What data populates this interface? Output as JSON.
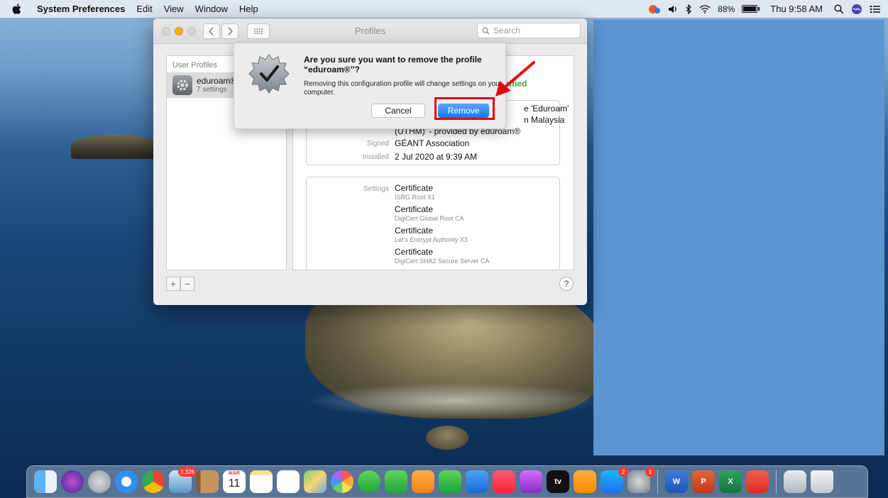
{
  "menubar": {
    "app_name": "System Preferences",
    "menus": [
      "Edit",
      "View",
      "Window",
      "Help"
    ],
    "battery": "88%",
    "battery_level": 0.88,
    "clock": "Thu 9:58 AM"
  },
  "window": {
    "title": "Profiles",
    "search_placeholder": "Search",
    "sidebar_header": "User Profiles",
    "profile_name": "eduroam®",
    "profile_settings": "7 settings",
    "verified": "rified",
    "info": {
      "line1": "e 'Eduroam'",
      "line2": "n Malaysia",
      "line3": "(UTHM)' - provided by eduroam®",
      "signed_label": "Signed",
      "signed_value": "GÉANT Association",
      "installed_label": "Installed",
      "installed_value": "2 Jul 2020 at 9:39 AM"
    },
    "settings_label": "Settings",
    "certificates": [
      {
        "title": "Certificate",
        "subtitle": "ISRG Root X1"
      },
      {
        "title": "Certificate",
        "subtitle": "DigiCert Global Root CA"
      },
      {
        "title": "Certificate",
        "subtitle": "Let's Encrypt Authority X3"
      },
      {
        "title": "Certificate",
        "subtitle": "DigiCert SHA2 Secure Server CA"
      }
    ],
    "help": "?"
  },
  "sheet": {
    "title": "Are you sure you want to remove the profile “eduroam®”?",
    "message": "Removing this configuration profile will change settings on your computer.",
    "cancel": "Cancel",
    "remove": "Remove"
  },
  "dock": {
    "photos_badge": "3,326",
    "calendar_month": "MAR",
    "calendar_day": "11",
    "appstore_badge": "2",
    "sysprefs_badge": "1",
    "tv_label": "tv",
    "word": "W",
    "powerpoint": "P",
    "excel": "X"
  },
  "colors": {
    "accent": "#1f74f0",
    "highlight": "#e3000b",
    "verified": "#3aa83a",
    "blue_rect": "#5b96d3"
  }
}
